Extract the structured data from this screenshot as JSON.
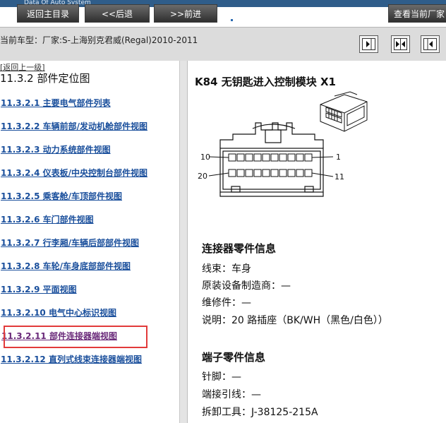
{
  "header": {
    "caption": "Data Of Auto System",
    "buttons": {
      "back_main": "返回主目录",
      "back": "<<后退",
      "forward": ">>前进",
      "view_current": "查看当前厂家"
    }
  },
  "vehicle": {
    "label": "当前车型：厂家:S-上海别克君威(Regal)2010-2011"
  },
  "sidebar": {
    "return_up": "[返回上一级]",
    "section_title": "11.3.2 部件定位图",
    "items": [
      {
        "label": "11.3.2.1 主要电气部件列表"
      },
      {
        "label": "11.3.2.2 车辆前部/发动机舱部件视图"
      },
      {
        "label": "11.3.2.3 动力系统部件视图"
      },
      {
        "label": "11.3.2.4 仪表板/中央控制台部件视图"
      },
      {
        "label": "11.3.2.5 乘客舱/车顶部件视图"
      },
      {
        "label": "11.3.2.6 车门部件视图"
      },
      {
        "label": "11.3.2.7 行李厢/车辆后部部件视图"
      },
      {
        "label": "11.3.2.8 车轮/车身底部部件视图"
      },
      {
        "label": "11.3.2.9 平面视图"
      },
      {
        "label": "11.3.2.10 电气中心标识视图"
      },
      {
        "label": "11.3.2.11 部件连接器端视图"
      },
      {
        "label": "11.3.2.12 直列式线束连接器端视图"
      }
    ]
  },
  "content": {
    "module_title": "K84 无钥匙进入控制模块  X1",
    "diagram_labels": {
      "pin_10": "10",
      "pin_1": "1",
      "pin_20": "20",
      "pin_11": "11"
    },
    "connector_info": {
      "title": "连接器零件信息",
      "lines": [
        "线束：车身",
        "原装设备制造商：—",
        "维修件：—",
        "说明：20 路插座（BK/WH（黑色/白色））"
      ]
    },
    "terminal_info": {
      "title": "端子零件信息",
      "lines": [
        "针脚：—",
        "端接引线：—",
        "拆卸工具：J-38125-215A"
      ]
    }
  }
}
